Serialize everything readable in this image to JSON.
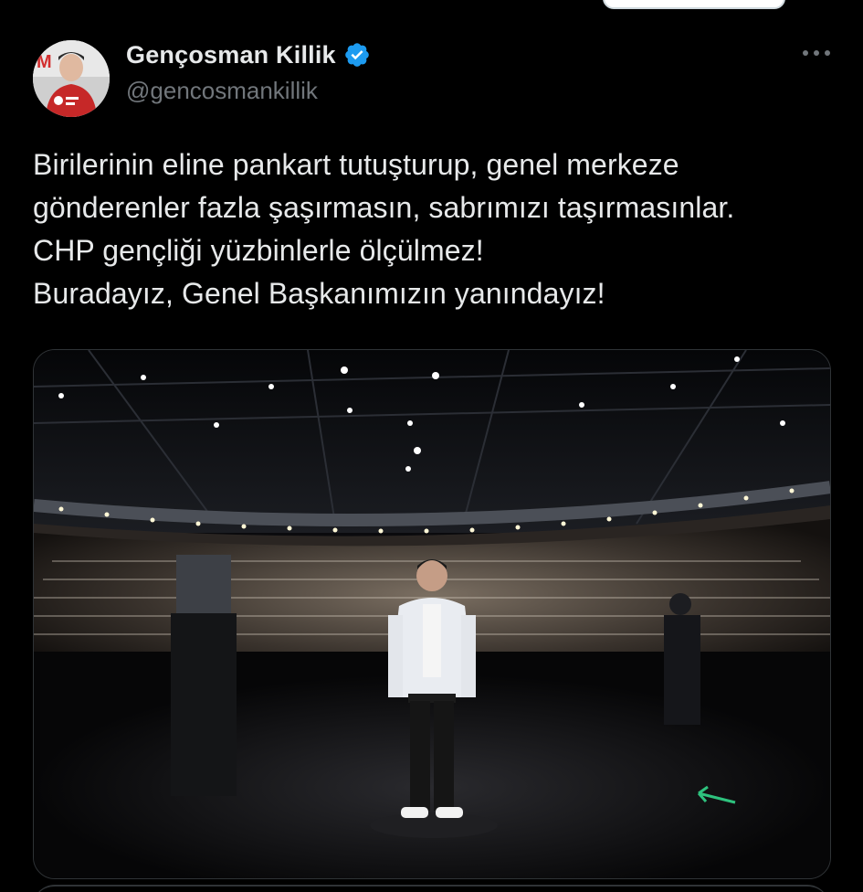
{
  "tweet": {
    "author": {
      "display_name": "Gençosman Killik",
      "handle": "@gencosmankillik",
      "verified": true,
      "avatar_icon": "profile-photo"
    },
    "more_icon": "more-horizontal-icon",
    "text_lines": [
      "Birilerinin eline pankart tutuşturup, genel merkeze",
      "gönderenler fazla şaşırmasın, sabrımızı taşırmasınlar.",
      "CHP gençliği yüzbinlerle ölçülmez!",
      "Buradayız, Genel Başkanımızın yanındayız!"
    ],
    "media": {
      "kind": "photo",
      "description_icon": "arena-stage-photo"
    }
  },
  "colors": {
    "background": "#000000",
    "text_primary": "#e7e9ea",
    "text_secondary": "#71767b",
    "verified_blue": "#1d9bf0",
    "border": "#2f3336"
  }
}
